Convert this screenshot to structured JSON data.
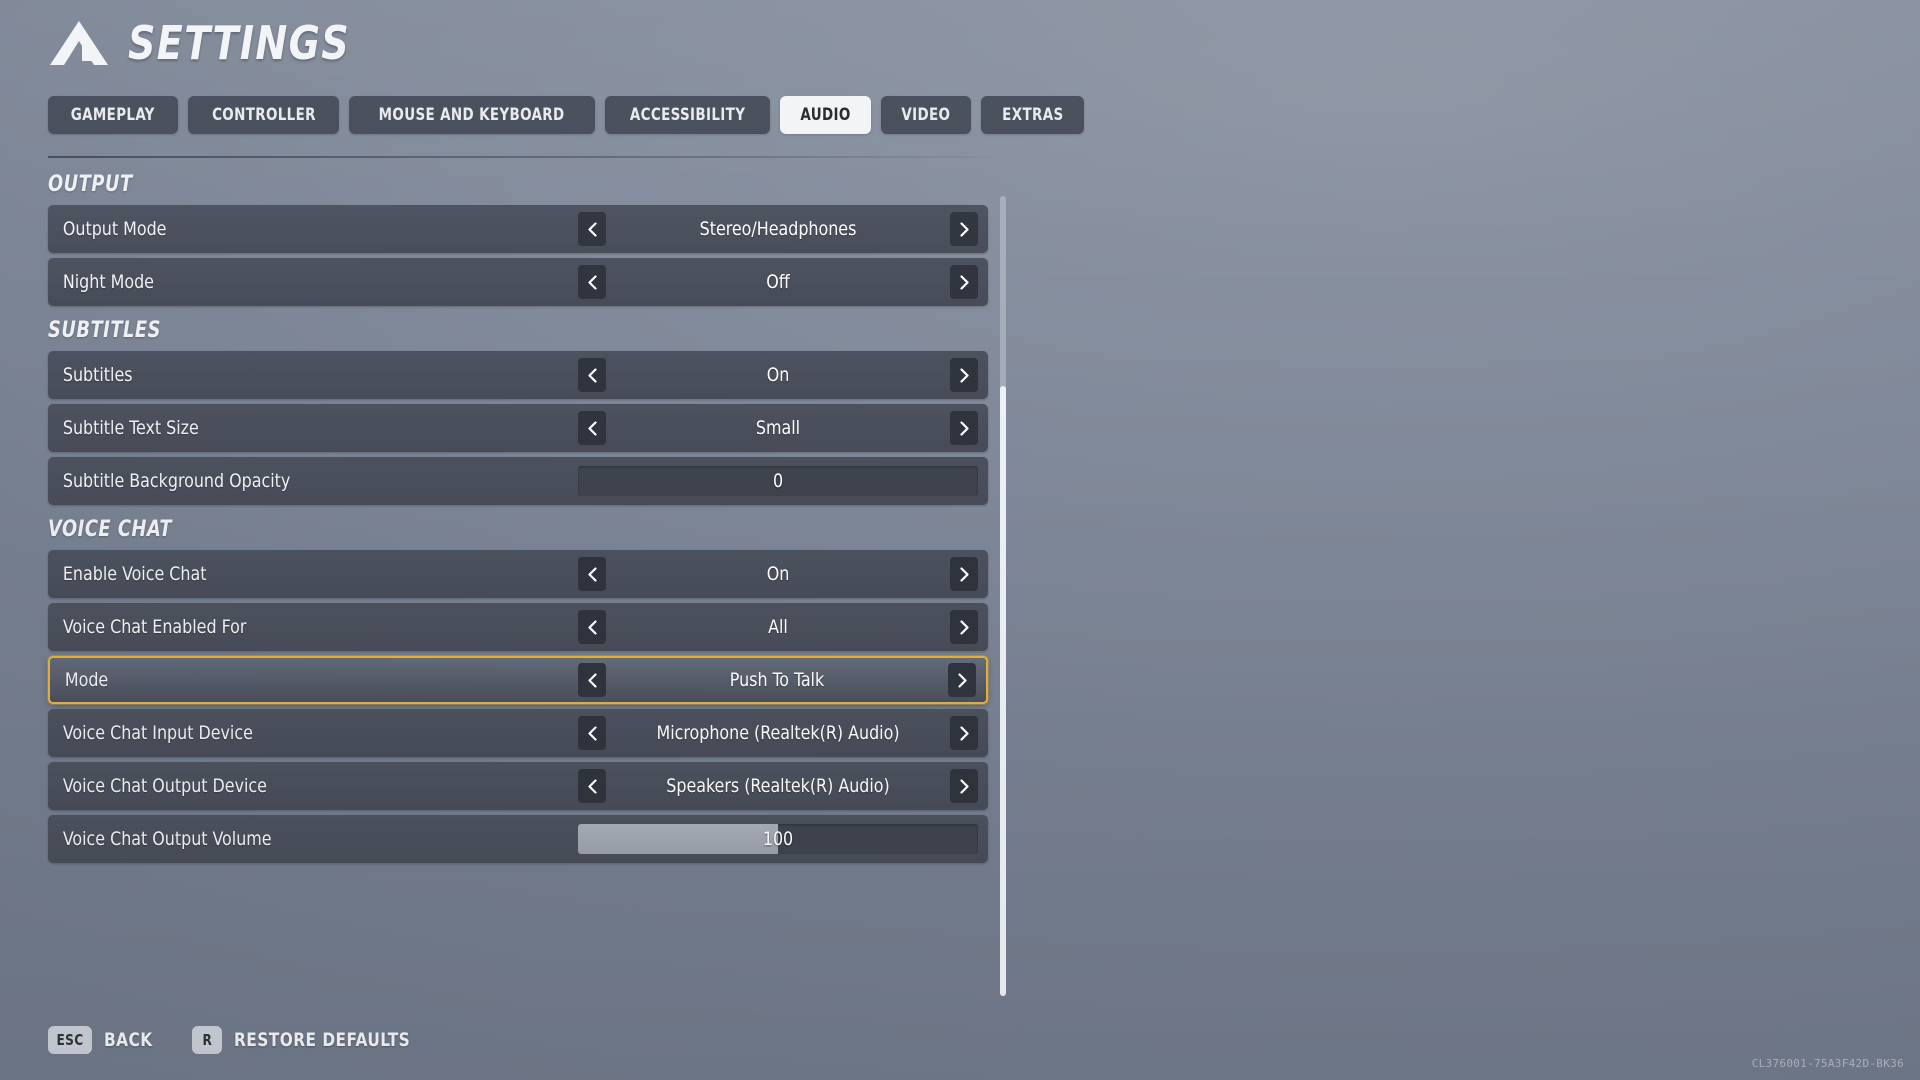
{
  "header": {
    "title": "SETTINGS",
    "logo_icon": "mountain-logo-icon"
  },
  "tabs": [
    {
      "label": "GAMEPLAY",
      "active": false
    },
    {
      "label": "CONTROLLER",
      "active": false
    },
    {
      "label": "MOUSE AND KEYBOARD",
      "active": false
    },
    {
      "label": "ACCESSIBILITY",
      "active": false
    },
    {
      "label": "AUDIO",
      "active": true
    },
    {
      "label": "VIDEO",
      "active": false
    },
    {
      "label": "EXTRAS",
      "active": false
    }
  ],
  "sections": [
    {
      "title": "OUTPUT",
      "rows": [
        {
          "label": "Output Mode",
          "type": "stepper",
          "value": "Stereo/Headphones",
          "selected": false
        },
        {
          "label": "Night Mode",
          "type": "stepper",
          "value": "Off",
          "selected": false
        }
      ]
    },
    {
      "title": "SUBTITLES",
      "rows": [
        {
          "label": "Subtitles",
          "type": "stepper",
          "value": "On",
          "selected": false
        },
        {
          "label": "Subtitle Text Size",
          "type": "stepper",
          "value": "Small",
          "selected": false
        },
        {
          "label": "Subtitle Background Opacity",
          "type": "slider",
          "value": "0",
          "fill_percent": 0,
          "selected": false
        }
      ]
    },
    {
      "title": "VOICE CHAT",
      "rows": [
        {
          "label": "Enable Voice Chat",
          "type": "stepper",
          "value": "On",
          "selected": false
        },
        {
          "label": "Voice Chat Enabled For",
          "type": "stepper",
          "value": "All",
          "selected": false
        },
        {
          "label": "Mode",
          "type": "stepper",
          "value": "Push To Talk",
          "selected": true
        },
        {
          "label": "Voice Chat Input Device",
          "type": "stepper",
          "value": "Microphone (Realtek(R) Audio)",
          "selected": false
        },
        {
          "label": "Voice Chat Output Device",
          "type": "stepper",
          "value": "Speakers (Realtek(R) Audio)",
          "selected": false
        },
        {
          "label": "Voice Chat Output Volume",
          "type": "slider",
          "value": "100",
          "fill_percent": 50,
          "selected": false
        }
      ]
    }
  ],
  "footer": {
    "items": [
      {
        "key": "ESC",
        "label": "BACK"
      },
      {
        "key": "R",
        "label": "RESTORE DEFAULTS"
      }
    ]
  },
  "build_id": "CL376001-75A3F42D-BK36",
  "colors": {
    "accent_selected": "#e3b23c",
    "tab_active_bg": "#f3f4f6",
    "row_bg": "#4b5060",
    "background": "#7d8697"
  }
}
